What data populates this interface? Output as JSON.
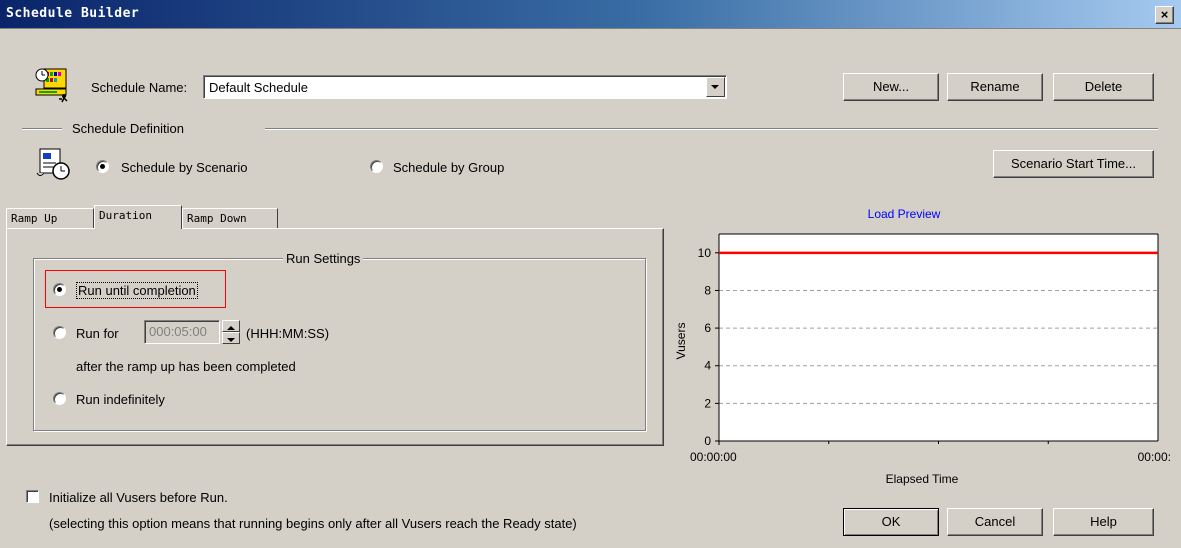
{
  "window": {
    "title": "Schedule Builder",
    "close_label": "×"
  },
  "schedule": {
    "name_label": "Schedule Name:",
    "name_value": "Default Schedule",
    "new_label": "New...",
    "rename_label": "Rename",
    "delete_label": "Delete"
  },
  "definition": {
    "section_label": "Schedule Definition",
    "by_scenario_label": "Schedule by Scenario",
    "by_group_label": "Schedule by Group",
    "selected": "scenario",
    "start_time_label": "Scenario Start Time..."
  },
  "tabs": [
    {
      "label": "Ramp Up"
    },
    {
      "label": "Duration"
    },
    {
      "label": "Ramp Down"
    }
  ],
  "active_tab": "Duration",
  "run_settings": {
    "title": "Run Settings",
    "until_completion_label": "Run until completion",
    "run_for_label": "Run for",
    "run_for_value": "000:05:00",
    "format_label": "(HHH:MM:SS)",
    "after_ramp_label": "after the ramp up has been completed",
    "indefinitely_label": "Run indefinitely",
    "selected": "until_completion"
  },
  "options": {
    "init_label": "Initialize all Vusers before Run.",
    "init_note": "(selecting this option means that running begins only after all Vusers reach the Ready state)",
    "init_checked": false
  },
  "buttons": {
    "ok_label": "OK",
    "cancel_label": "Cancel",
    "help_label": "Help"
  },
  "chart_data": {
    "type": "line",
    "title": "Load Preview",
    "xlabel": "Elapsed Time",
    "ylabel": "Vusers",
    "x_tick_labels": [
      "00:00:00",
      "00:00:"
    ],
    "y_ticks": [
      0,
      2,
      4,
      6,
      8,
      10
    ],
    "ylim": [
      0,
      11
    ],
    "grid": true,
    "series": [
      {
        "x": [
          0,
          1
        ],
        "values": [
          10,
          10
        ],
        "color": "#ff0000"
      }
    ]
  },
  "colors": {
    "accent_title": "#0000ff",
    "highlight_box": "#ff0000",
    "series": "#ff0000"
  },
  "icons": {
    "schedule": "schedule-clock-runner-icon",
    "definition": "scroll-clock-icon"
  }
}
